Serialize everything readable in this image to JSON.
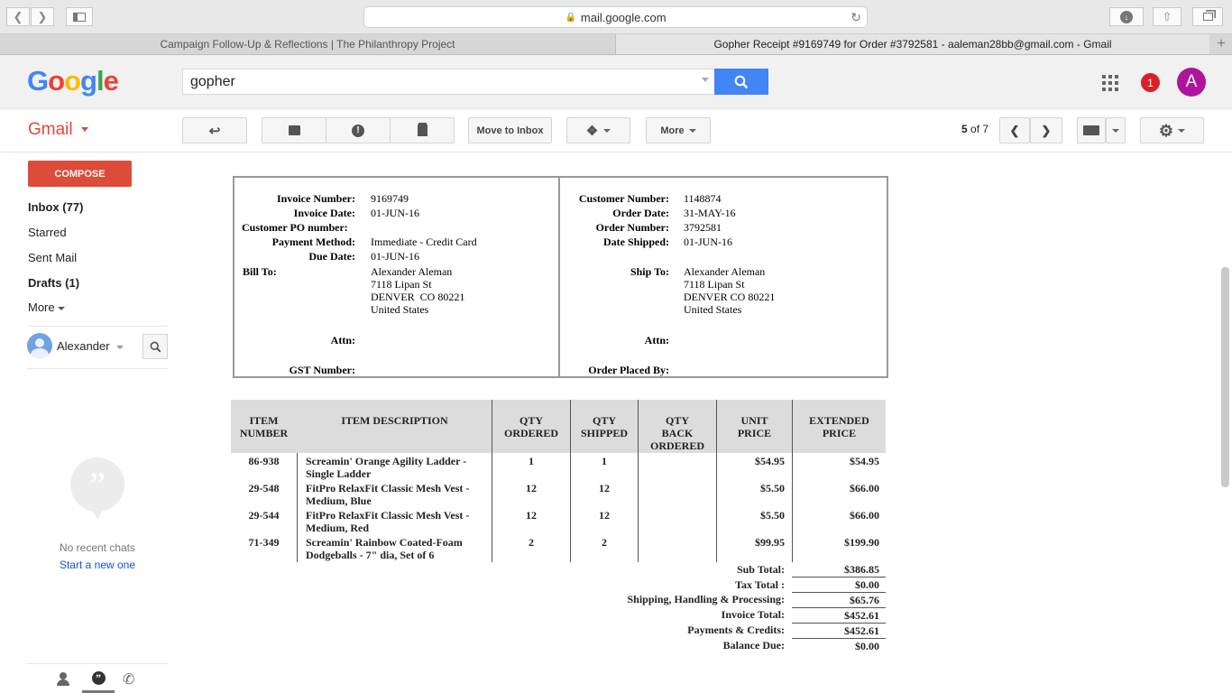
{
  "browser": {
    "url": "mail.google.com",
    "tabs": [
      {
        "label": "Campaign Follow-Up & Reflections | The Philanthropy Project"
      },
      {
        "label": "Gopher Receipt #9169749 for Order #3792581 - aaleman28bb@gmail.com - Gmail"
      }
    ]
  },
  "header": {
    "search_value": "gopher",
    "notification_count": "1",
    "avatar_letter": "A"
  },
  "actionbar": {
    "app_label": "Gmail",
    "move_to_inbox": "Move to Inbox",
    "more": "More",
    "pager_current": "5",
    "pager_rest": " of 7"
  },
  "sidebar": {
    "compose": "COMPOSE",
    "items": [
      {
        "label": "Inbox (77)"
      },
      {
        "label": "Starred"
      },
      {
        "label": "Sent Mail"
      },
      {
        "label": "Drafts (1)"
      },
      {
        "label": "More"
      }
    ],
    "user": "Alexander",
    "no_chats": "No recent chats",
    "start_new": "Start a new one"
  },
  "invoice": {
    "left": {
      "labels": [
        "Invoice Number:",
        "Invoice Date:",
        "Customer PO number:",
        "Payment Method:",
        "Due Date:",
        "Bill To:",
        "Attn:",
        "GST Number:"
      ],
      "invoice_number": "9169749",
      "invoice_date": "01-JUN-16",
      "payment_method": "Immediate - Credit Card",
      "due_date": "01-JUN-16",
      "bill_to": [
        "Alexander Aleman",
        "7118 Lipan St",
        "DENVER  CO 80221",
        "United States"
      ]
    },
    "right": {
      "labels": [
        "Customer Number:",
        "Order Date:",
        "Order Number:",
        "Date Shipped:",
        "Ship To:",
        "Attn:",
        "Order Placed By:"
      ],
      "customer_number": "1148874",
      "order_date": "31-MAY-16",
      "order_number": "3792581",
      "date_shipped": "01-JUN-16",
      "ship_to": [
        "Alexander Aleman",
        "7118 Lipan St",
        "DENVER CO 80221",
        "United States"
      ]
    },
    "columns": {
      "item_number": [
        "ITEM",
        "NUMBER"
      ],
      "description": "ITEM DESCRIPTION",
      "qty_ordered": [
        "QTY",
        "ORDERED"
      ],
      "qty_shipped": [
        "QTY",
        "SHIPPED"
      ],
      "qty_back": [
        "QTY",
        "BACK",
        "ORDERED"
      ],
      "unit_price": [
        "UNIT",
        "PRICE"
      ],
      "extended_price": [
        "EXTENDED",
        "PRICE"
      ]
    },
    "items": [
      {
        "number": "86-938",
        "desc1": "Screamin' Orange Agility Ladder -",
        "desc2": "Single Ladder",
        "ordered": "1",
        "shipped": "1",
        "unit": "$54.95",
        "ext": "$54.95"
      },
      {
        "number": "29-548",
        "desc1": "FitPro RelaxFit Classic Mesh Vest -",
        "desc2": "Medium, Blue",
        "ordered": "12",
        "shipped": "12",
        "unit": "$5.50",
        "ext": "$66.00"
      },
      {
        "number": "29-544",
        "desc1": "FitPro RelaxFit Classic Mesh Vest -",
        "desc2": "Medium, Red",
        "ordered": "12",
        "shipped": "12",
        "unit": "$5.50",
        "ext": "$66.00"
      },
      {
        "number": "71-349",
        "desc1": "Screamin' Rainbow Coated-Foam",
        "desc2": "Dodgeballs - 7\" dia, Set of 6",
        "ordered": "2",
        "shipped": "2",
        "unit": "$99.95",
        "ext": "$199.90"
      }
    ],
    "totals": [
      {
        "label": "Sub Total:",
        "value": "$386.85"
      },
      {
        "label": "Tax Total :",
        "value": "$0.00"
      },
      {
        "label": "Shipping, Handling & Processing:",
        "value": "$65.76"
      },
      {
        "label": "Invoice Total:",
        "value": "$452.61"
      },
      {
        "label": "Payments & Credits:",
        "value": "$452.61"
      },
      {
        "label": "Balance Due:",
        "value": "$0.00"
      }
    ]
  }
}
